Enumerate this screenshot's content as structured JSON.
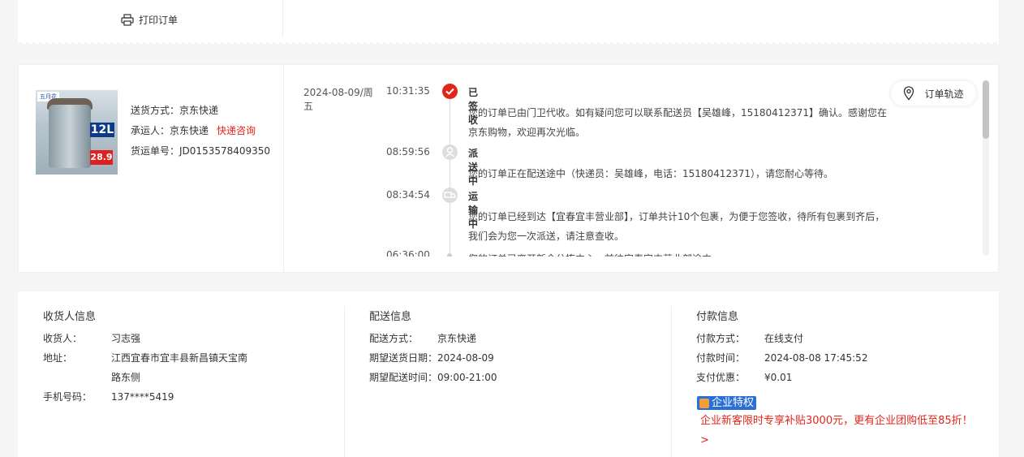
{
  "top": {
    "print_label": "打印订单"
  },
  "shipping": {
    "method_label": "送货方式：",
    "method_value": "京东快递",
    "carrier_label": "承运人：",
    "carrier_value": "京东快递",
    "carrier_link": "快递咨询",
    "tracking_label": "货运单号：",
    "tracking_value": "JD0153578409350",
    "product_badge_size": "12L",
    "product_badge_price": "28.9",
    "product_brand": "五月花"
  },
  "tracking_button": "订单轨迹",
  "timeline": [
    {
      "date": "2024-08-09/周五",
      "time": "10:31:35",
      "title": "已签收",
      "desc": "您的订单已由门卫代收。如有疑问您可以联系配送员【吴雄峰，15180412371】确认。感谢您在京东购物，欢迎再次光临。",
      "icon": "check-icon"
    },
    {
      "date": "",
      "time": "08:59:56",
      "title": "派送中",
      "desc": "您的订单正在配送途中（快递员：吴雄峰，电话：15180412371），请您耐心等待。",
      "icon": "courier-icon"
    },
    {
      "date": "",
      "time": "08:34:54",
      "title": "运输中",
      "desc": "您的订单已经到达【宜春宜丰营业部】，订单共计10个包裹，为便于您签收，待所有包裹到齐后，我们会为您一次派送，请注意查收。",
      "icon": "truck-icon"
    },
    {
      "date": "",
      "time": "06:36:00",
      "title": "",
      "desc": "您的订单已离开新余分拣中心，前往宜春宜丰营业部途中",
      "icon": "dot"
    }
  ],
  "receiver": {
    "heading": "收货人信息",
    "name_label": "收货人：",
    "name_value": "习志强",
    "address_label": "地址：",
    "address_value": "江西宜春市宜丰县新昌镇天宝南路东侧",
    "phone_label": "手机号码：",
    "phone_value": "137****5419"
  },
  "delivery": {
    "heading": "配送信息",
    "method_label": "配送方式：",
    "method_value": "京东快递",
    "date_label": "期望送货日期：",
    "date_value": "2024-08-09",
    "time_label": "期望配送时间：",
    "time_value": "09:00-21:00"
  },
  "payment": {
    "heading": "付款信息",
    "method_label": "付款方式：",
    "method_value": "在线支付",
    "time_label": "付款时间：",
    "time_value": "2024-08-08 17:45:52",
    "discount_label": "支付优惠：",
    "discount_value": "¥0.01",
    "badge": "企业特权",
    "promo": "企业新客限时专享补贴3000元，更有企业团购低至85折！ >"
  },
  "colors": {
    "accent": "#e1251b",
    "badge_blue": "#2a6fd6"
  }
}
